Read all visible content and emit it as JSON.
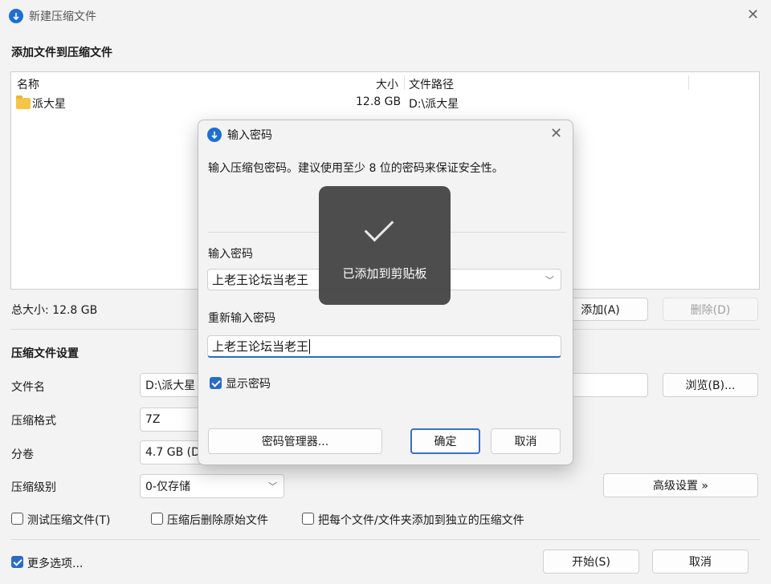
{
  "window": {
    "title": "新建压缩文件"
  },
  "add_files": {
    "heading": "添加文件到压缩文件",
    "columns": {
      "name": "名称",
      "size": "大小",
      "path": "文件路径"
    },
    "rows": [
      {
        "name": "派大星",
        "size": "12.8 GB",
        "path": "D:\\派大星"
      }
    ],
    "total_size": "总大小: 12.8 GB",
    "add_button": "添加(A)",
    "delete_button": "删除(D)"
  },
  "settings": {
    "heading": "压缩文件设置",
    "filename_label": "文件名",
    "filename_value": "D:\\派大星",
    "browse_button": "浏览(B)...",
    "format_label": "压缩格式",
    "format_value": "7Z",
    "split_label": "分卷",
    "split_value": "4.7 GB (D",
    "level_label": "压缩级别",
    "level_value": "0-仅存储",
    "advanced_button": "高级设置 »",
    "test_checkbox": "测试压缩文件(T)",
    "delete_source_checkbox": "压缩后删除原始文件",
    "separate_checkbox": "把每个文件/文件夹添加到独立的压缩文件"
  },
  "footer": {
    "more_options": "更多选项...",
    "start_button": "开始(S)",
    "cancel_button": "取消"
  },
  "password_dialog": {
    "title": "输入密码",
    "description": "输入压缩包密码。建议使用至少 8 位的密码来保证安全性。",
    "password_label": "输入密码",
    "password_value": "上老王论坛当老王",
    "confirm_label": "重新输入密码",
    "confirm_value": "上老王论坛当老王",
    "show_password": "显示密码",
    "manager_button": "密码管理器...",
    "ok_button": "确定",
    "cancel_button": "取消"
  },
  "toast": {
    "text": "已添加到剪贴板"
  },
  "colors": {
    "accent": "#2a6bc7",
    "folder": "#f3c645",
    "toast_bg": "#464646"
  }
}
